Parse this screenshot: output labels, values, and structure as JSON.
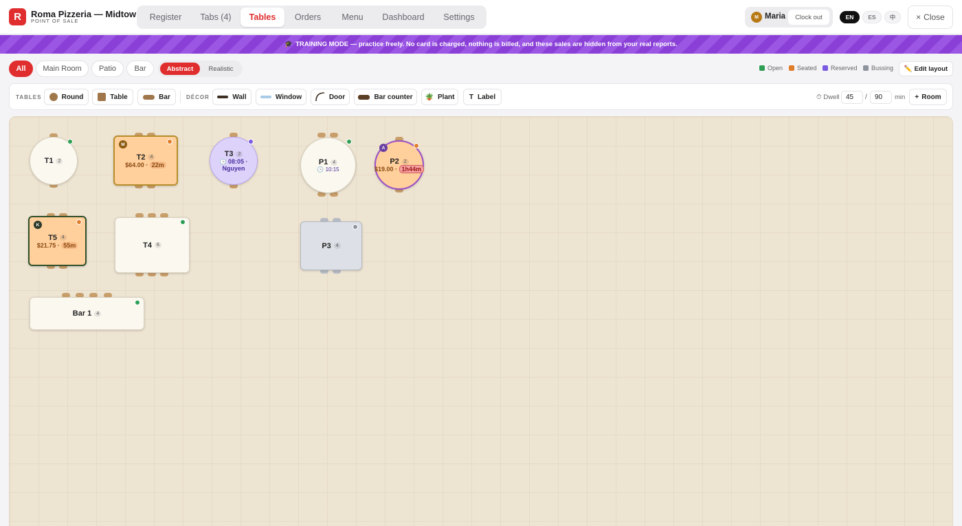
{
  "header": {
    "logo_letter": "R",
    "title": "Roma Pizzeria — Midtown",
    "subtitle": "POINT OF SALE",
    "tabs": [
      {
        "label": "Register"
      },
      {
        "label": "Tabs (4)"
      },
      {
        "label": "Tables",
        "active": true
      },
      {
        "label": "Orders"
      },
      {
        "label": "Menu"
      },
      {
        "label": "Dashboard"
      },
      {
        "label": "Settings"
      }
    ],
    "user": {
      "initial": "M",
      "name": "Maria",
      "clock_out": "Clock out"
    },
    "languages": [
      "EN",
      "ES",
      "中"
    ],
    "active_language": "EN",
    "close": {
      "icon": "×",
      "label": "Close"
    }
  },
  "banner": {
    "icon": "🎓",
    "text": "TRAINING MODE — practice freely. No card is charged, nothing is billed, and these sales are hidden from your real reports."
  },
  "filters": {
    "rooms": [
      "All",
      "Main Room",
      "Patio",
      "Bar"
    ],
    "active_room": "All",
    "modes": [
      "Abstract",
      "Realistic"
    ],
    "active_mode": "Abstract"
  },
  "legend": [
    {
      "label": "Open",
      "color": "#2f9e55"
    },
    {
      "label": "Seated",
      "color": "#e07d2a"
    },
    {
      "label": "Reserved",
      "color": "#7a5ae0"
    },
    {
      "label": "Bussing",
      "color": "#8e949e"
    }
  ],
  "edit_layout": {
    "icon": "✏️",
    "label": "Edit layout"
  },
  "toolbar": {
    "tables_label": "TABLES",
    "decor_label": "DÉCOR",
    "tables": [
      {
        "label": "Round",
        "icon": "round-table-icon"
      },
      {
        "label": "Table",
        "icon": "square-table-icon"
      },
      {
        "label": "Bar",
        "icon": "bar-table-icon"
      }
    ],
    "decor": [
      {
        "label": "Wall",
        "icon": "wall-icon"
      },
      {
        "label": "Window",
        "icon": "window-icon"
      },
      {
        "label": "Door",
        "icon": "door-icon"
      },
      {
        "label": "Bar counter",
        "icon": "bar-counter-icon"
      },
      {
        "label": "Plant",
        "icon": "🪴"
      },
      {
        "label": "Label",
        "icon": "T"
      }
    ],
    "dwell": {
      "icon": "⏱",
      "label": "Dwell",
      "warn": "45",
      "max": "90",
      "separator": "/",
      "unit": "min"
    },
    "add_room": {
      "icon": "+",
      "label": "Room"
    }
  },
  "floor": {
    "tables": {
      "t1": {
        "name": "T1",
        "capacity": "2",
        "status": "open"
      },
      "t2": {
        "name": "T2",
        "capacity": "4",
        "status": "seated",
        "server": "M",
        "amount": "$64.00",
        "sep": "·",
        "dwell": "22m"
      },
      "t3": {
        "name": "T3",
        "capacity": "2",
        "status": "reserved",
        "time_icon": "🕒",
        "time": "08:05",
        "sep": "·",
        "guest": "Nguyen"
      },
      "p1": {
        "name": "P1",
        "capacity": "4",
        "status": "open",
        "time_icon": "🕒",
        "time": "10:15"
      },
      "p2": {
        "name": "P2",
        "capacity": "2",
        "status": "seated",
        "server": "A",
        "amount": "$19.00",
        "sep": "·",
        "dwell": "1h44m"
      },
      "t5": {
        "name": "T5",
        "capacity": "4",
        "status": "seated",
        "server": "K",
        "amount": "$21.75",
        "sep": "·",
        "dwell": "55m"
      },
      "t4": {
        "name": "T4",
        "capacity": "6",
        "status": "open"
      },
      "p3": {
        "name": "P3",
        "capacity": "4",
        "status": "bussing"
      },
      "bar1": {
        "name": "Bar 1",
        "capacity": "4",
        "status": "open"
      }
    }
  },
  "colors": {
    "brand": "#e02d2d",
    "training": "#8a3fd6",
    "seated_fill": "#ffcf9c",
    "reserved_fill": "#ddd3fa",
    "bussing_fill": "#dde0e6",
    "floor": "#eee4d2"
  }
}
